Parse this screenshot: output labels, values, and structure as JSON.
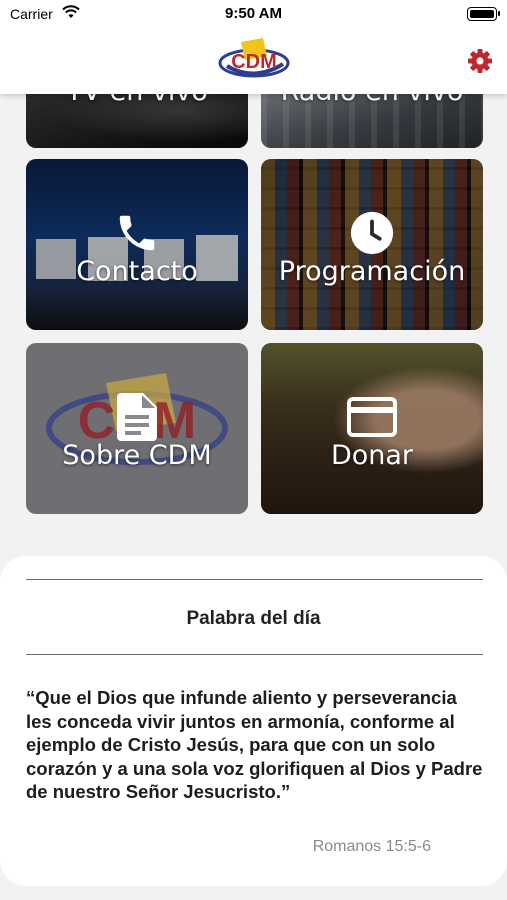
{
  "status_bar": {
    "carrier": "Carrier",
    "time": "9:50 AM"
  },
  "nav": {
    "logo_text": "CDM",
    "settings_icon": "gear-icon",
    "accent_color": "#c0272d"
  },
  "tiles": [
    {
      "label": "TV en vivo",
      "icon": "tv-icon"
    },
    {
      "label": "Radio en vivo",
      "icon": "radio-icon"
    },
    {
      "label": "Contacto",
      "icon": "phone-icon"
    },
    {
      "label": "Programación",
      "icon": "clock-icon"
    },
    {
      "label": "Sobre CDM",
      "icon": "document-icon"
    },
    {
      "label": "Donar",
      "icon": "credit-card-icon"
    }
  ],
  "verse": {
    "title": "Palabra del día",
    "text": "“Que el Dios que infunde aliento y perseverancia les conceda vivir juntos en armonía, conforme al ejemplo de Cristo Jesús, para que con un solo corazón y a una sola voz glorifiquen al Dios y Padre de nuestro Señor Jesucristo.”",
    "reference": "Romanos 15:5-6"
  }
}
